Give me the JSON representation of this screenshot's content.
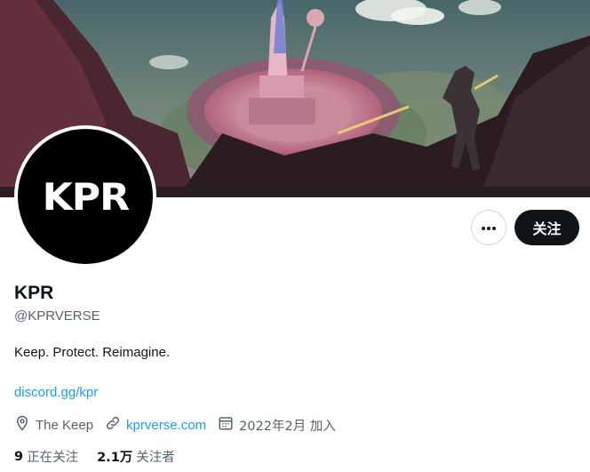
{
  "profile": {
    "avatar_text": "KPR",
    "name": "KPR",
    "handle": "@KPRVERSE",
    "bio": "Keep. Protect. Reimagine.",
    "bio_link": "discord.gg/kpr",
    "location": "The Keep",
    "website": "kprverse.com",
    "joined": "2022年2月 加入"
  },
  "actions": {
    "follow_label": "关注"
  },
  "stats": {
    "following_count": "9",
    "following_label": "正在关注",
    "followers_count": "2.1万",
    "followers_label": "关注者"
  },
  "colors": {
    "link": "#1d9bf0",
    "secondary_text": "#536471",
    "primary_text": "#0f1419"
  },
  "icons": {
    "more": "more-dots-icon",
    "location": "location-pin-icon",
    "website": "link-icon",
    "joined": "calendar-icon"
  }
}
